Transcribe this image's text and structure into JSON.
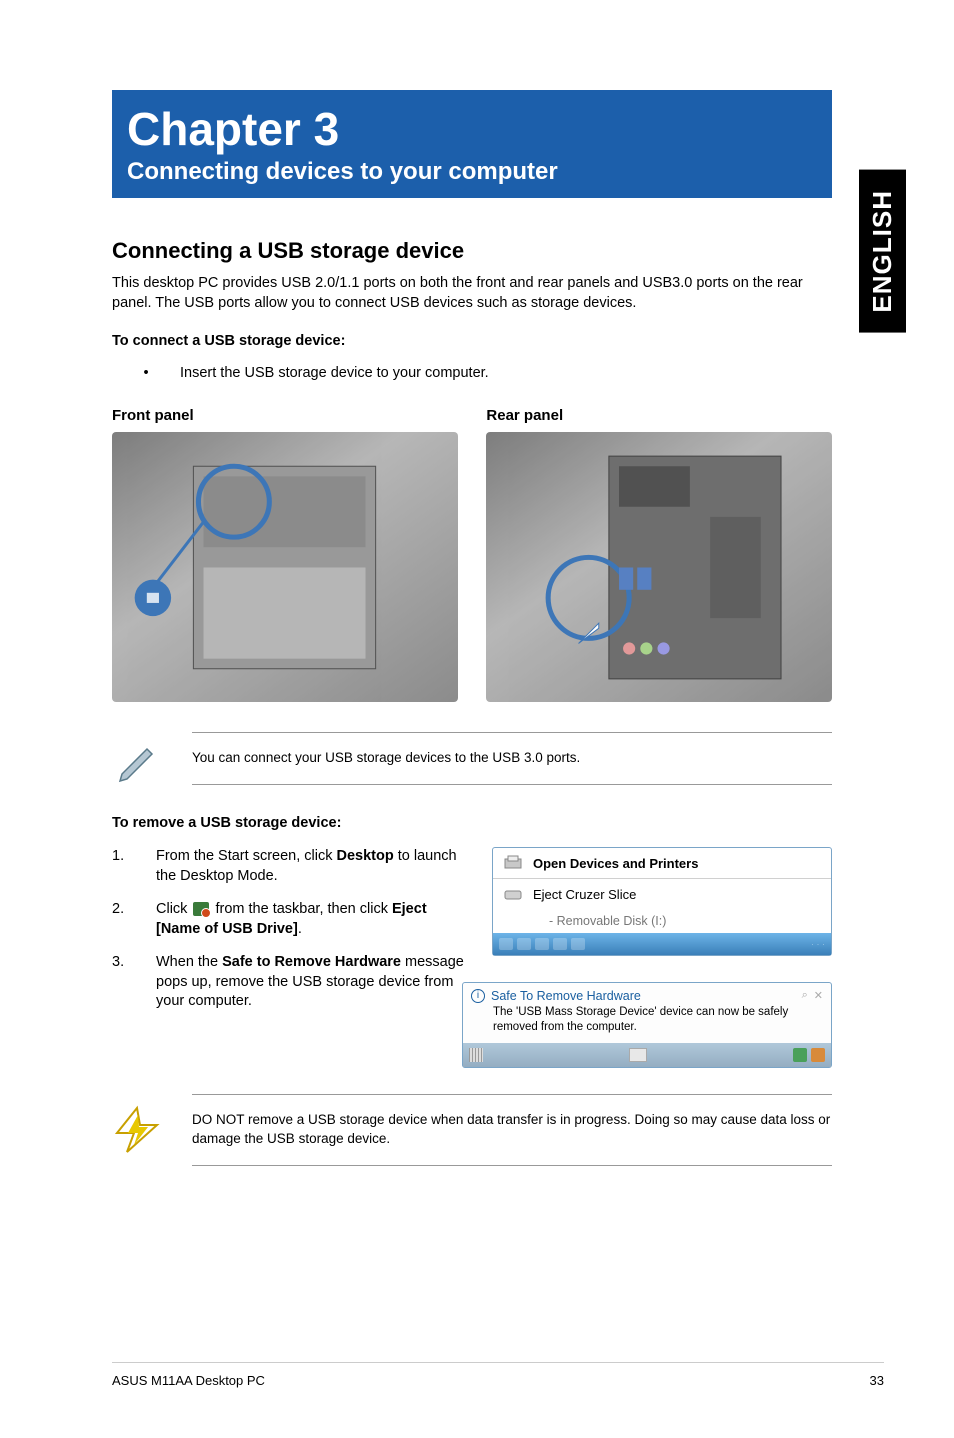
{
  "sideTab": "ENGLISH",
  "chapter": {
    "title": "Chapter 3",
    "subtitle": "Connecting devices to your computer"
  },
  "section1": {
    "title": "Connecting a USB storage device",
    "intro": "This desktop PC provides USB 2.0/1.1 ports on both the front and rear panels and USB3.0 ports on the rear panel. The USB ports allow you to connect USB devices such as storage devices.",
    "connectHeading": "To connect a USB storage device:",
    "connectStep": "Insert the USB storage device to your computer.",
    "frontLabel": "Front panel",
    "rearLabel": "Rear panel"
  },
  "note1": "You can connect your USB storage devices to the USB 3.0 ports.",
  "removeSection": {
    "heading": "To remove a USB storage device:",
    "step1_prefix": "From the Start screen, click ",
    "step1_bold": "Desktop",
    "step1_suffix": " to launch the Desktop Mode.",
    "step2_prefix": "Click ",
    "step2_mid": " from the taskbar, then click ",
    "step2_bold1": "Eject [Name of USB Drive]",
    "step2_suffix": ".",
    "step3_prefix": "When the ",
    "step3_bold": "Safe to Remove Hardware",
    "step3_suffix": " message pops up, remove the USB storage device from your computer."
  },
  "popup": {
    "openDevices": "Open Devices and Printers",
    "ejectCruzer": "Eject Cruzer Slice",
    "removableDisk": "-   Removable Disk (I:)"
  },
  "notif": {
    "title": "Safe To Remove Hardware",
    "body": "The 'USB Mass Storage Device' device can now be safely removed from the computer."
  },
  "warning": "DO NOT remove a USB storage device when data transfer is in progress. Doing so may cause data loss or damage the USB storage device.",
  "footer": {
    "left": "ASUS M11AA Desktop PC",
    "right": "33"
  }
}
